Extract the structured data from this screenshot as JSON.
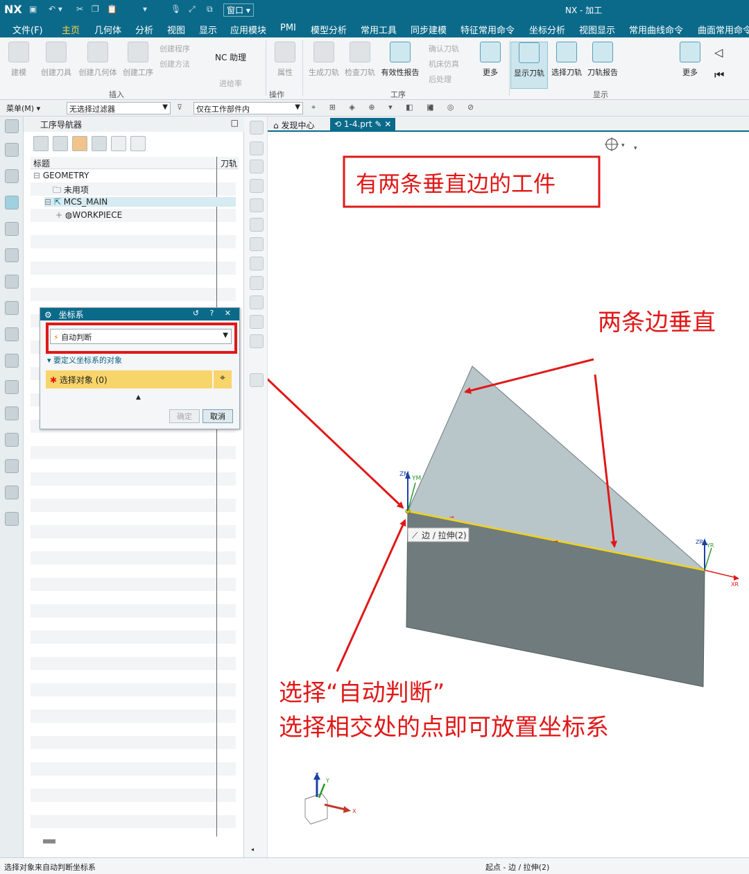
{
  "app": {
    "logo": "NX",
    "title": "NX - 加工",
    "window_menu": "窗口 ▾"
  },
  "tabs": [
    {
      "label": "文件(F)"
    },
    {
      "label": "主页"
    },
    {
      "label": "几何体"
    },
    {
      "label": "分析"
    },
    {
      "label": "视图"
    },
    {
      "label": "显示"
    },
    {
      "label": "应用模块"
    },
    {
      "label": "PMI"
    },
    {
      "label": "模型分析"
    },
    {
      "label": "常用工具"
    },
    {
      "label": "同步建模"
    },
    {
      "label": "特征常用命令"
    },
    {
      "label": "坐标分析"
    },
    {
      "label": "视图显示"
    },
    {
      "label": "常用曲线命令"
    },
    {
      "label": "曲面常用命令"
    }
  ],
  "ribbon": {
    "build": "建模",
    "create_tool": "创建刀具",
    "create_geometry": "创建几何体",
    "create_operation": "创建工序",
    "create_program": "创建程序",
    "create_method": "创建方法",
    "nc_assistant": "NC 助理",
    "feed_rate": "进给率",
    "properties": "属性",
    "generate_toolpath": "生成刀轨",
    "verify_toolpath": "检查刀轨",
    "validity_report": "有效性报告",
    "confirm_toolpath": "确认刀轨",
    "machine_sim": "机床仿真",
    "postprocess": "后处理",
    "more1": "更多",
    "show_toolpath": "显示刀轨",
    "select_toolpath": "选择刀轨",
    "toolpath_report": "刀轨报告",
    "more2": "更多",
    "group_insert": "插入",
    "group_operation": "操作",
    "group_process": "工序",
    "group_display": "显示"
  },
  "filterbar": {
    "menu": "菜单(M) ▾",
    "filter": "无选择过滤器",
    "scope": "仅在工作部件内"
  },
  "navigator": {
    "title": "工序导航器",
    "col_name": "标题",
    "col_path": "刀轨",
    "items": [
      "GEOMETRY",
      "未用项",
      "MCS_MAIN",
      "WORKPIECE"
    ]
  },
  "dialog": {
    "title": "坐标系",
    "type_value": "自动判断",
    "section": "要定义坐标系的对象",
    "select_object": "选择对象 (0)",
    "ok": "确定",
    "cancel": "取消"
  },
  "doctabs": [
    "发现中心",
    "1-4.prt"
  ],
  "model": {
    "zm": "ZM",
    "ym": "YM",
    "zr": "ZR",
    "yr": "YR",
    "xr": "XR",
    "edge_tip": "边 / 拉伸(2)",
    "triad_z": "Z",
    "triad_y": "Y",
    "triad_x": "X"
  },
  "annotations": {
    "box_title": "有两条垂直边的工件",
    "perp": "两条边垂直",
    "note_line1": "选择“自动判断”",
    "note_line2": "选择相交处的点即可放置坐标系"
  },
  "status": {
    "left": "选择对象来自动判断坐标系",
    "right": "起点 - 边 / 拉伸(2)"
  },
  "colors": {
    "accent": "#0b6a8a",
    "annotation_red": "#e01818",
    "select_yellow": "#f7d56b"
  }
}
